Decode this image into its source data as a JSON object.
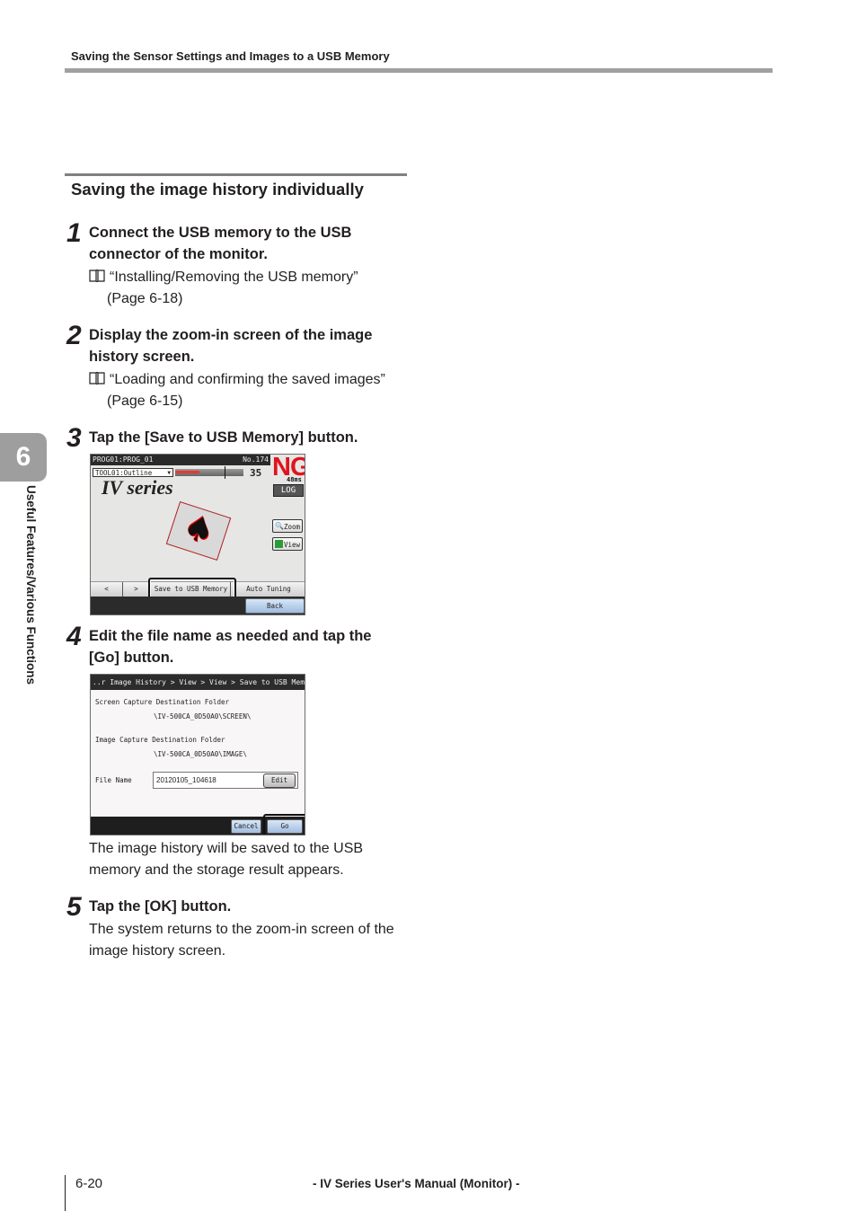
{
  "header": {
    "running_head": "Saving the Sensor Settings and Images to a USB Memory"
  },
  "chapter": {
    "number": "6",
    "side_label": "Useful Features/Various Functions"
  },
  "section": {
    "title": "Saving the image history individually"
  },
  "steps": [
    {
      "number": "1",
      "title_line1": "Connect the USB memory to the USB",
      "title_line2": "connector of the monitor.",
      "ref_line1": "“Installing/Removing the USB memory”",
      "ref_line2": "(Page 6-18)"
    },
    {
      "number": "2",
      "title_line1": "Display the zoom-in screen of the image",
      "title_line2": "history screen.",
      "ref_line1": "“Loading and confirming the saved images”",
      "ref_line2": "(Page 6-15)"
    },
    {
      "number": "3",
      "title_line1": "Tap the [Save to USB Memory] button."
    },
    {
      "number": "4",
      "title_line1": "Edit the file name as needed and tap the",
      "title_line2": "[Go] button.",
      "body_line1": "The image history will be saved to the USB",
      "body_line2": "memory and the storage result appears."
    },
    {
      "number": "5",
      "title_line1": "Tap the [OK] button.",
      "body_line1": "The system returns to the zoom-in screen of the",
      "body_line2": "image history screen."
    }
  ],
  "screen1": {
    "program": "PROG01:PROG_01",
    "image_no": "No.174",
    "tool_select": "TOOL01:Outline",
    "match_value": "35",
    "match_bar_fraction": 0.35,
    "threshold_fraction": 0.72,
    "result": "NG",
    "time": "48ms",
    "log_button": "LOG",
    "logo_text": "IV series",
    "zoom_button": "Zoom",
    "view_button": "View",
    "prev_button": "<",
    "next_button": ">",
    "save_button": "Save to USB Memory",
    "auto_tuning_button": "Auto Tuning",
    "back_button": "Back",
    "colors": {
      "ng": "#e0141e",
      "bar_fill": "#e53935"
    }
  },
  "screen2": {
    "breadcrumb": "..r Image History > View > View > Save to USB Memory",
    "screen_capture_label": "Screen Capture Destination Folder",
    "screen_capture_path": "\\IV-500CA_0D50A0\\SCREEN\\",
    "image_capture_label": "Image Capture Destination Folder",
    "image_capture_path": "\\IV-500CA_0D50A0\\IMAGE\\",
    "file_name_label": "File Name",
    "file_name_value": "20120105_104618",
    "edit_button": "Edit",
    "cancel_button": "Cancel",
    "go_button": "Go"
  },
  "footer": {
    "page_number": "6-20",
    "manual_title": "- IV Series User's Manual (Monitor) -"
  }
}
